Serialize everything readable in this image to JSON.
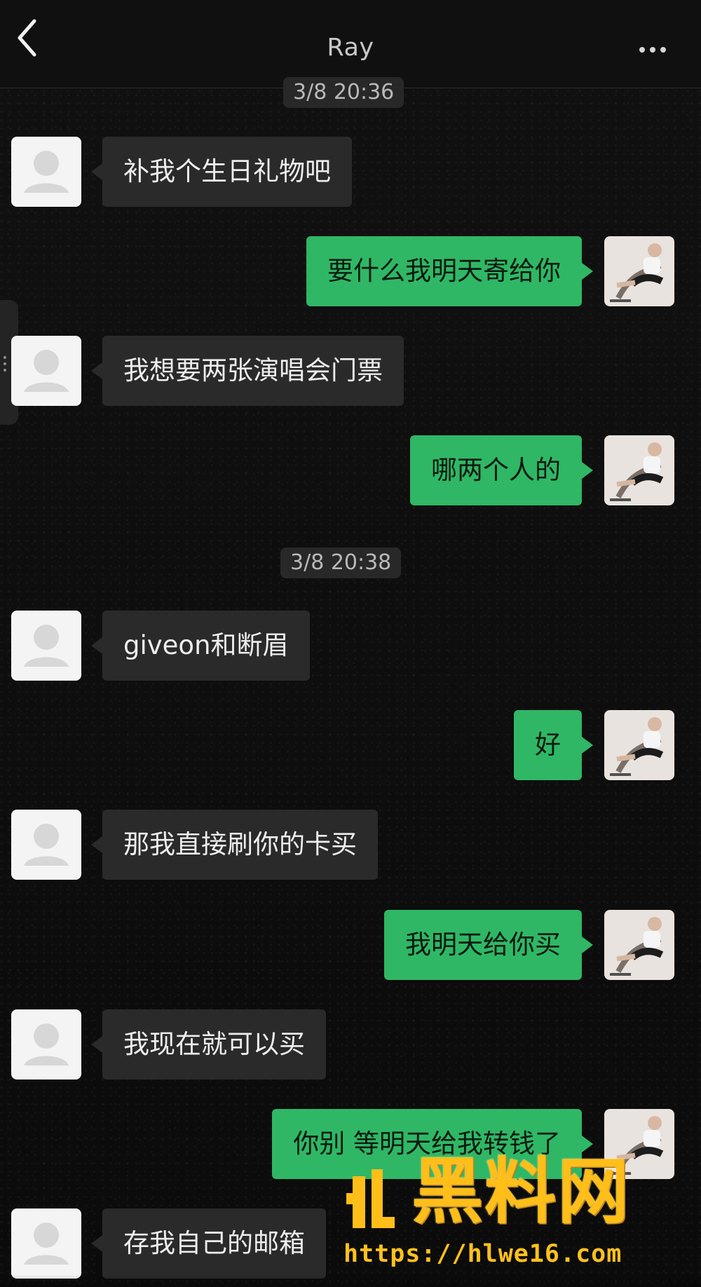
{
  "header": {
    "title": "Ray",
    "back_icon": "chevron-left-icon",
    "more_icon": "more-horizontal-icon"
  },
  "timestamps": {
    "top_partial": "3/8 20:36",
    "middle": "3/8 20:38"
  },
  "messages": [
    {
      "side": "left",
      "text": "补我个生日礼物吧"
    },
    {
      "side": "right",
      "text": "要什么我明天寄给你"
    },
    {
      "side": "left",
      "text": "我想要两张演唱会门票"
    },
    {
      "side": "right",
      "text": "哪两个人的"
    },
    {
      "side": "left",
      "text": "giveon和断眉"
    },
    {
      "side": "right",
      "text": "好"
    },
    {
      "side": "left",
      "text": "那我直接刷你的卡买"
    },
    {
      "side": "right",
      "text": "我明天给你买"
    },
    {
      "side": "left",
      "text": "我现在就可以买"
    },
    {
      "side": "right",
      "text": "你别 等明天给我转钱了"
    },
    {
      "side": "left",
      "text": "存我自己的邮箱"
    }
  ],
  "watermark": {
    "brand": "黑料网",
    "url": "https://hlwe16.com"
  },
  "colors": {
    "background": "#111111",
    "left_bubble": "#2a2a2a",
    "right_bubble": "#2fb765",
    "watermark": "#ffbe18"
  }
}
